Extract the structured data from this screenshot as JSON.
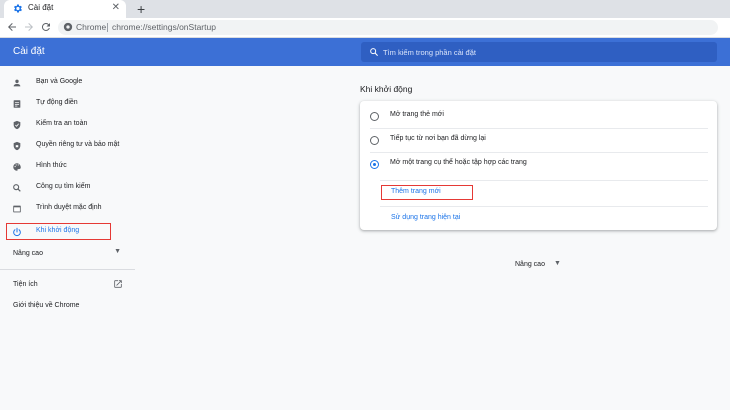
{
  "browser": {
    "tab_title": "Cài đặt",
    "tab_close": "✕",
    "new_tab": "+",
    "omnibox_label": "Chrome",
    "url": "chrome://settings/onStartup"
  },
  "header": {
    "title": "Cài đặt",
    "search_placeholder": "Tìm kiếm trong phần cài đặt"
  },
  "sidebar": {
    "items": [
      {
        "label": "Bạn và Google",
        "icon": "person-icon"
      },
      {
        "label": "Tự động điền",
        "icon": "clipboard-icon"
      },
      {
        "label": "Kiểm tra an toàn",
        "icon": "shield-icon"
      },
      {
        "label": "Quyền riêng tư và bảo mật",
        "icon": "shield-lock-icon"
      },
      {
        "label": "Hình thức",
        "icon": "palette-icon"
      },
      {
        "label": "Công cụ tìm kiếm",
        "icon": "search-icon"
      },
      {
        "label": "Trình duyệt mặc định",
        "icon": "browser-icon"
      },
      {
        "label": "Khi khởi động",
        "icon": "power-icon",
        "active": true
      }
    ],
    "advanced_label": "Nâng cao",
    "extensions_label": "Tiện ích",
    "about_label": "Giới thiệu về Chrome"
  },
  "main": {
    "section_title": "Khi khởi động",
    "options": [
      {
        "label": "Mở trang thẻ mới",
        "checked": false
      },
      {
        "label": "Tiếp tục từ nơi bạn đã dừng lại",
        "checked": false
      },
      {
        "label": "Mở một trang cụ thể hoặc tập hợp các trang",
        "checked": true
      }
    ],
    "add_page_link": "Thêm trang mới",
    "use_current_link": "Sử dụng trang hiện tại",
    "advanced_label": "Nâng cao"
  },
  "colors": {
    "header_bg": "#3c70d6",
    "accent": "#1a73e8",
    "highlight_box": "#e53935"
  }
}
